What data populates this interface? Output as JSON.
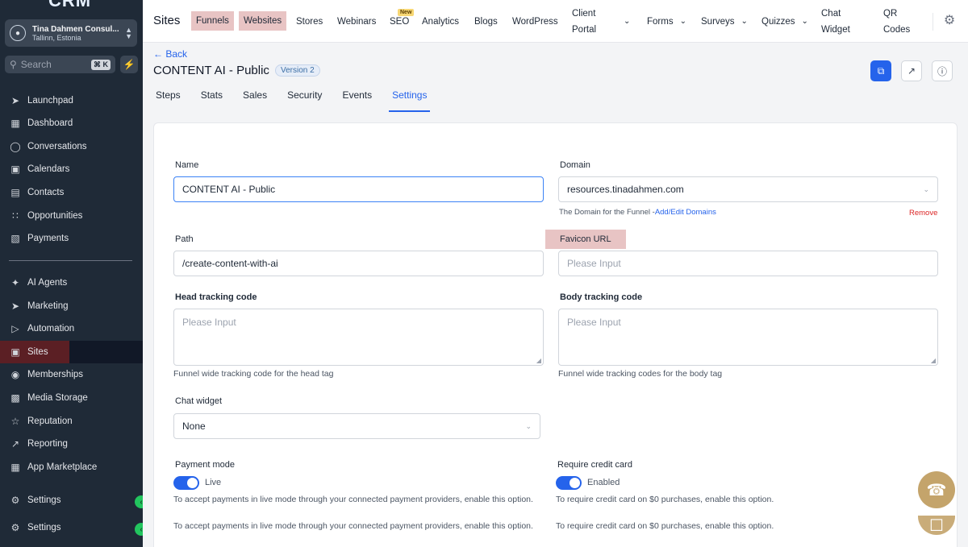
{
  "sidebar": {
    "brand": "CRM",
    "account": {
      "name": "Tina Dahmen Consul...",
      "location": "Tallinn, Estonia"
    },
    "search": {
      "placeholder": "Search",
      "shortcut": "⌘ K"
    },
    "items_top": [
      {
        "label": "Launchpad",
        "icon": "rocket-icon"
      },
      {
        "label": "Dashboard",
        "icon": "grid-icon"
      },
      {
        "label": "Conversations",
        "icon": "chat-icon"
      },
      {
        "label": "Calendars",
        "icon": "calendar-icon"
      },
      {
        "label": "Contacts",
        "icon": "contacts-icon"
      },
      {
        "label": "Opportunities",
        "icon": "opportunities-icon"
      },
      {
        "label": "Payments",
        "icon": "payments-icon"
      }
    ],
    "items_bottom": [
      {
        "label": "AI Agents",
        "icon": "sparkle-icon"
      },
      {
        "label": "Marketing",
        "icon": "send-icon"
      },
      {
        "label": "Automation",
        "icon": "automation-icon"
      },
      {
        "label": "Sites",
        "icon": "sites-icon",
        "active": true
      },
      {
        "label": "Memberships",
        "icon": "memberships-icon"
      },
      {
        "label": "Media Storage",
        "icon": "image-icon"
      },
      {
        "label": "Reputation",
        "icon": "star-icon"
      },
      {
        "label": "Reporting",
        "icon": "trend-icon"
      },
      {
        "label": "App Marketplace",
        "icon": "apps-icon"
      }
    ],
    "settings": [
      "Settings",
      "Settings"
    ]
  },
  "topbar": {
    "title": "Sites",
    "items": [
      "Funnels",
      "Websites",
      "Stores",
      "Webinars",
      "SEO",
      "Analytics",
      "Blogs",
      "WordPress",
      "Client Portal",
      "Forms",
      "Surveys",
      "Quizzes",
      "Chat Widget",
      "QR Codes"
    ],
    "new_badge": "New"
  },
  "page": {
    "back": "← Back",
    "title": "CONTENT AI - Public",
    "version": "Version 2",
    "tabs": [
      "Steps",
      "Stats",
      "Sales",
      "Security",
      "Events",
      "Settings"
    ]
  },
  "form": {
    "name": {
      "label": "Name",
      "value": "CONTENT AI - Public"
    },
    "domain": {
      "label": "Domain",
      "value": "resources.tinadahmen.com",
      "help": "The Domain for the Funnel -",
      "help_link": "Add/Edit Domains",
      "remove": "Remove"
    },
    "path": {
      "label": "Path",
      "value": "/create-content-with-ai"
    },
    "favicon": {
      "label": "Favicon URL",
      "placeholder": "Please Input"
    },
    "head_code": {
      "label": "Head tracking code",
      "placeholder": "Please Input",
      "help": "Funnel wide tracking code for the head tag"
    },
    "body_code": {
      "label": "Body tracking code",
      "placeholder": "Please Input",
      "help": "Funnel wide tracking codes for the body tag"
    },
    "chat_widget": {
      "label": "Chat widget",
      "value": "None"
    },
    "payment_mode": {
      "label": "Payment mode",
      "toggle": "Live",
      "help1": "To accept payments in live mode through your connected payment providers, enable this option.",
      "help2": "To accept payments in live mode through your connected payment providers, enable this option."
    },
    "credit_card": {
      "label": "Require credit card",
      "toggle": "Enabled",
      "help1": "To require credit card on $0 purchases, enable this option.",
      "help2": "To require credit card on $0 purchases, enable this option."
    }
  },
  "colors": {
    "accent": "#2563eb",
    "sidebar": "#1f2a37",
    "highlight": "#e8c4c4",
    "fab": "#c4a46b"
  }
}
